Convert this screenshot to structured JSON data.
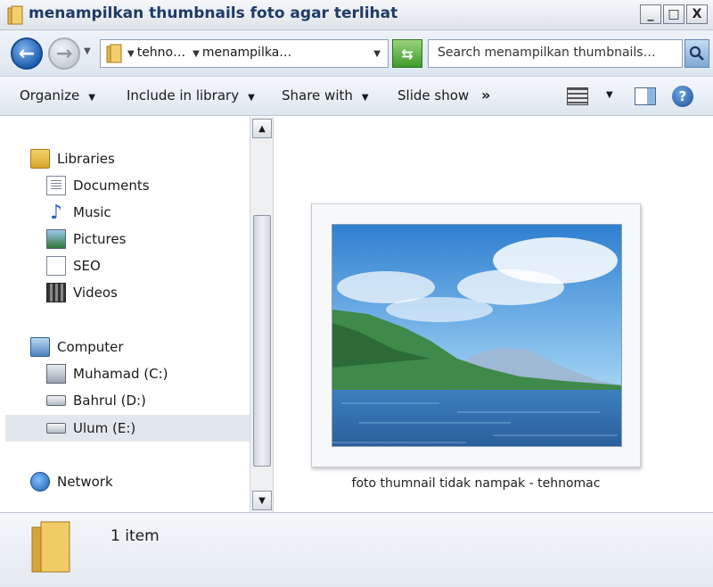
{
  "window": {
    "title": "menampilkan thumbnails foto agar terlihat",
    "controls": {
      "minimize": "_",
      "maximize": "□",
      "close": "X"
    }
  },
  "address": {
    "crumbs": [
      "tehno…",
      "menampilka…"
    ],
    "search_placeholder": "Search menampilkan thumbnails…"
  },
  "toolbar": {
    "organize": "Organize",
    "include_in_library": "Include in library",
    "share_with": "Share with",
    "slide_show": "Slide show",
    "more": "»",
    "help": "?"
  },
  "navigation": {
    "libraries": {
      "label": "Libraries",
      "items": [
        "Documents",
        "Music",
        "Pictures",
        "SEO",
        "Videos"
      ]
    },
    "computer": {
      "label": "Computer",
      "items": [
        "Muhamad (C:)",
        "Bahrul (D:)",
        "Ulum (E:)"
      ],
      "selected": "Ulum (E:)"
    },
    "network": {
      "label": "Network"
    }
  },
  "content": {
    "files": [
      {
        "name": "foto thumnail tidak nampak - tehnomac"
      }
    ]
  },
  "details": {
    "item_count": "1 item"
  },
  "colors": {
    "title_text": "#1f3b66",
    "selection": "#e2e7ec",
    "folder": "#e3b64a"
  }
}
